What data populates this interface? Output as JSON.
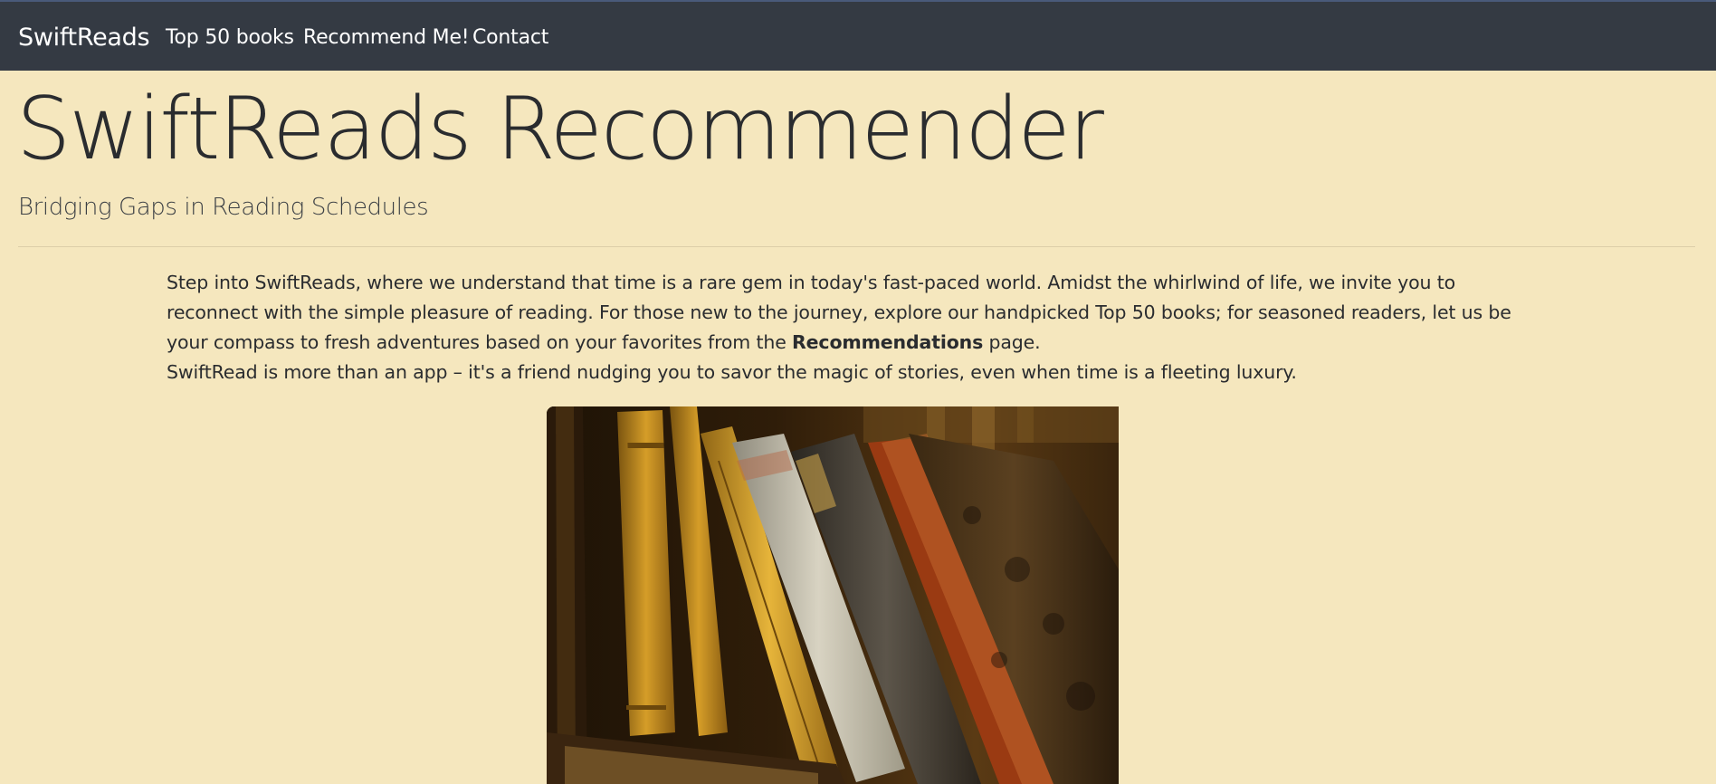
{
  "navbar": {
    "brand": "SwiftReads",
    "links": [
      {
        "label": "Top 50 books"
      },
      {
        "label": "Recommend Me!"
      },
      {
        "label": "Contact"
      }
    ]
  },
  "hero": {
    "title": "SwiftReads Recommender",
    "subtitle": "Bridging Gaps in Reading Schedules"
  },
  "intro": {
    "paragraph_1_part_1": "Step into SwiftReads, where we understand that time is a rare gem in today's fast-paced world. Amidst the whirlwind of life, we invite you to reconnect with the simple pleasure of reading. For those new to the journey, explore our handpicked Top 50 books; for seasoned readers, let us be your compass to fresh adventures based on your favorites from the ",
    "paragraph_1_bold": "Recommendations",
    "paragraph_1_part_2": " page.",
    "paragraph_2": "SwiftRead is more than an app – it's a friend nudging you to savor the magic of stories, even when time is a fleeting luxury."
  },
  "image": {
    "subject": "old books on a shelf"
  }
}
